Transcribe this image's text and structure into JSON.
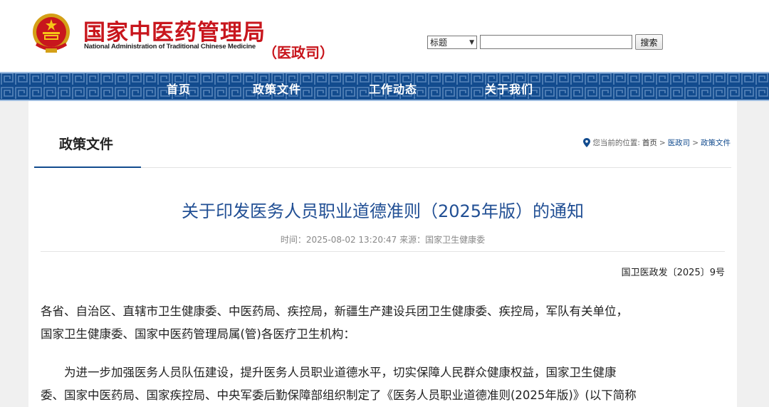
{
  "header": {
    "org_name_cn": "国家中医药管理局",
    "org_name_en": "National Administration of Traditional Chinese Medicine",
    "department": "（医政司）",
    "emblem_icon": "national-emblem-icon",
    "search": {
      "select_value": "标题",
      "input_value": "",
      "button_label": "搜索"
    }
  },
  "nav": {
    "items": [
      {
        "label": "首页"
      },
      {
        "label": "政策文件"
      },
      {
        "label": "工作动态"
      },
      {
        "label": "关于我们"
      }
    ],
    "color": "#124b8e"
  },
  "section": {
    "title": "政策文件"
  },
  "breadcrumb": {
    "prefix": "您当前的位置:",
    "items": [
      "首页",
      "医政司",
      "政策文件"
    ],
    "separator": ">"
  },
  "article": {
    "title": "关于印发医务人员职业道德准则（2025年版）的通知",
    "meta": "时间：2025-08-02 13:20:47 来源：国家卫生健康委",
    "doc_number": "国卫医政发〔2025〕9号",
    "recipients_lines": [
      "各省、自治区、直辖市卫生健康委、中医药局、疾控局，新疆生产建设兵团卫生健康委、疾控局，军队有关单位，",
      "国家卫生健康委、国家中医药管理局属(管)各医疗卫生机构："
    ],
    "body_lines": [
      "　　为进一步加强医务人员队伍建设，提升医务人员职业道德水平，切实保障人民群众健康权益，国家卫生健康",
      "委、国家中医药局、国家疾控局、中央军委后勤保障部组织制定了《医务人员职业道德准则(2025年版)》(以下简称"
    ]
  },
  "colors": {
    "brand_red": "#c8161d",
    "title_blue": "#214f94"
  }
}
